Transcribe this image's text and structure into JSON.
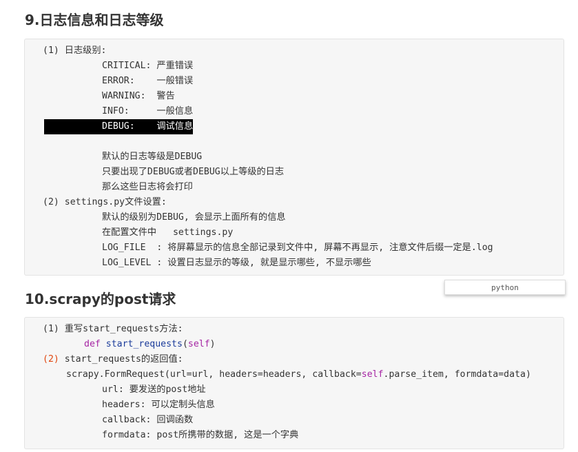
{
  "section9": {
    "heading": "9.日志信息和日志等级",
    "lines": [
      "(1) 日志级别:",
      "CRITICAL: 严重错误",
      "ERROR:    一般错误",
      "WARNING:  警告",
      "INFO:     一般信息",
      "DEBUG:    调试信息",
      "默认的日志等级是DEBUG",
      "只要出现了DEBUG或者DEBUG以上等级的日志",
      "那么这些日志将会打印",
      "(2) settings.py文件设置:",
      "默认的级别为DEBUG, 会显示上面所有的信息",
      "在配置文件中   settings.py",
      "LOG_FILE  : 将屏幕显示的信息全部记录到文件中, 屏幕不再显示, 注意文件后缀一定是.log",
      "LOG_LEVEL : 设置日志显示的等级, 就是显示哪些, 不显示哪些"
    ]
  },
  "lang_tag": "python",
  "section10": {
    "heading": "10.scrapy的post请求",
    "l1": "(1) 重写start_requests方法:",
    "l2_kw": "def",
    "l2_fn": "start_requests",
    "l2_open": "(",
    "l2_self": "self",
    "l2_close": ")",
    "l3_num": "(2)",
    "l3_rest": " start_requests的返回值:",
    "l4_a": "scrapy.FormRequest(url=url, headers=headers, callback=",
    "l4_self": "self",
    "l4_b": ".parse_item, formdata=data)",
    "l5": "url: 要发送的post地址",
    "l6": "headers: 可以定制头信息",
    "l7": "callback: 回调函数",
    "l8": "formdata: post所携带的数据, 这是一个字典"
  },
  "colors": {
    "code_background": "#f6f6f6",
    "keyword": "#a626a4",
    "function": "#1a3b9a",
    "number": "#e0450e",
    "selection": "#000000"
  }
}
